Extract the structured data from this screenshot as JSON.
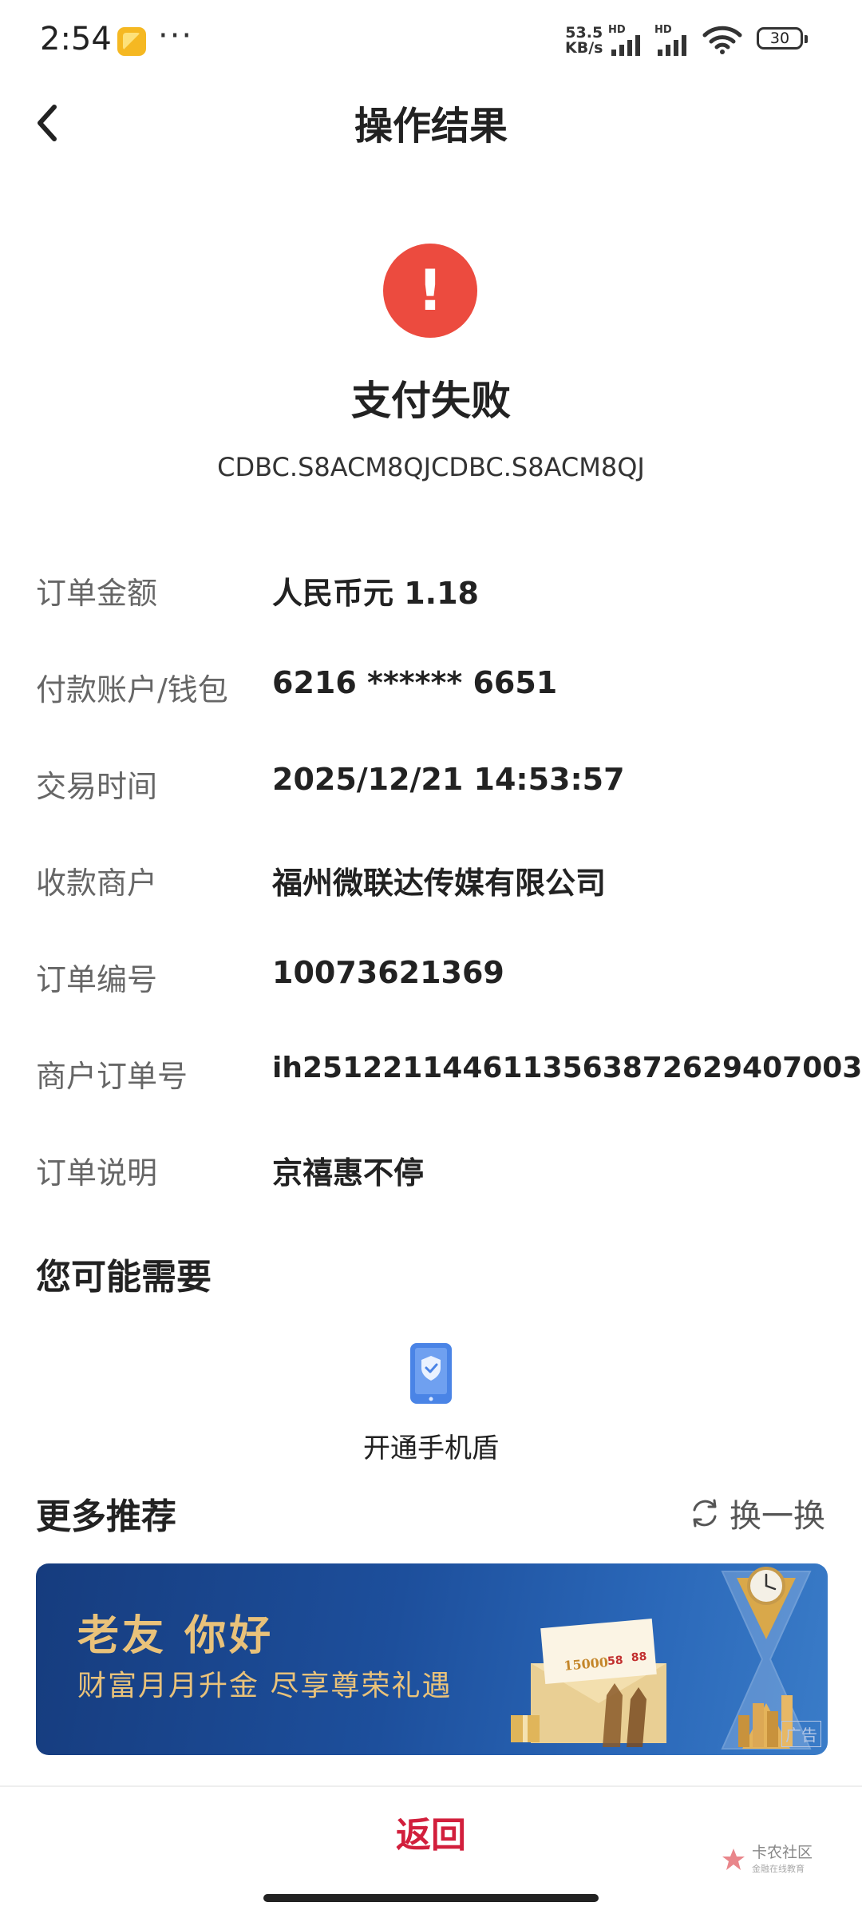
{
  "status_bar": {
    "time": "2:54",
    "network_speed_value": "53.5",
    "network_speed_unit": "KB/s",
    "signal_1_label": "HD",
    "signal_2_label": "HD",
    "battery": "30",
    "icons": [
      "app-notification-icon",
      "more-dots-icon",
      "signal-icon",
      "wifi-icon",
      "battery-icon"
    ]
  },
  "header": {
    "title": "操作结果"
  },
  "result": {
    "status": "支付失败",
    "serial": "CDBC.S8ACM8QJCDBC.S8ACM8QJ",
    "icon_color": "#ec4b3f"
  },
  "details": [
    {
      "label": "订单金额",
      "value": "人民币元 1.18"
    },
    {
      "label": "付款账户/钱包",
      "value": "6216 ****** 6651"
    },
    {
      "label": "交易时间",
      "value": "2025/12/21 14:53:57"
    },
    {
      "label": "收款商户",
      "value": "福州微联达传媒有限公司"
    },
    {
      "label": "订单编号",
      "value": "10073621369"
    },
    {
      "label": "商户订单号",
      "value": "ih25122114461135638726294070​03"
    },
    {
      "label": "订单说明",
      "value": "京禧惠不停"
    }
  ],
  "you_may_need": {
    "title": "您可能需要",
    "items": [
      {
        "label": "开通手机盾",
        "icon": "phone-shield-icon"
      }
    ]
  },
  "recommend": {
    "title": "更多推荐",
    "refresh_label": "换一换",
    "banner": {
      "headline": "老友 你好",
      "subline": "财富月月升金 尽享尊荣礼遇",
      "ad_tag": "广告",
      "card_number": "15000",
      "card_num2": "58",
      "card_num3": "88"
    }
  },
  "footer": {
    "return_label": "返回",
    "watermark_text": "卡农社区",
    "watermark_sub": "金融在线教育",
    "accent_color": "#d21f3c"
  }
}
